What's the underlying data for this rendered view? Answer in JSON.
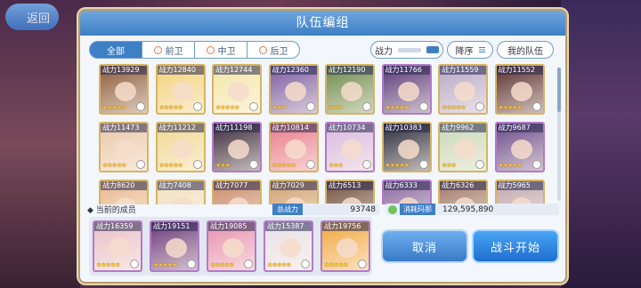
{
  "back_label": "返回",
  "panel_title": "队伍编组",
  "filter_tabs": [
    {
      "label": "全部",
      "active": true
    },
    {
      "label": "前卫",
      "active": false
    },
    {
      "label": "中卫",
      "active": false
    },
    {
      "label": "后卫",
      "active": false
    }
  ],
  "sort_field_label": "战力",
  "sort_order_label": "降序",
  "my_team_label": "我的队伍",
  "power_prefix": "战力",
  "roster": [
    {
      "power": "13929",
      "stars": 5,
      "frame": "gold",
      "color": "#8a5a3a"
    },
    {
      "power": "12840",
      "stars": 5,
      "frame": "gold",
      "color": "#f2d27a"
    },
    {
      "power": "12744",
      "stars": 5,
      "frame": "gold",
      "color": "#f5e6a8"
    },
    {
      "power": "12360",
      "stars": 3,
      "frame": "gold",
      "color": "#7a5aa0"
    },
    {
      "power": "12190",
      "stars": 3,
      "frame": "gold",
      "color": "#6a8a4a"
    },
    {
      "power": "11766",
      "stars": 5,
      "frame": "purple",
      "color": "#5a3a7a"
    },
    {
      "power": "11559",
      "stars": 5,
      "frame": "gold",
      "color": "#b6a8c8"
    },
    {
      "power": "11552",
      "stars": 5,
      "frame": "gold",
      "color": "#5a3030"
    },
    {
      "power": "11473",
      "stars": 5,
      "frame": "gold",
      "color": "#e9c8a8"
    },
    {
      "power": "11212",
      "stars": 5,
      "frame": "gold",
      "color": "#f0d890"
    },
    {
      "power": "11198",
      "stars": 3,
      "frame": "purple",
      "color": "#3a2a3a"
    },
    {
      "power": "10814",
      "stars": 5,
      "frame": "gold",
      "color": "#e87a8a"
    },
    {
      "power": "10734",
      "stars": 3,
      "frame": "purple",
      "color": "#d8b8e0"
    },
    {
      "power": "10383",
      "stars": 5,
      "frame": "gold",
      "color": "#2a2a3a"
    },
    {
      "power": "9962",
      "stars": 3,
      "frame": "gold",
      "color": "#c8d8b8"
    },
    {
      "power": "9687",
      "stars": 5,
      "frame": "purple",
      "color": "#6a4a8a"
    },
    {
      "power": "8620",
      "stars": 5,
      "frame": "gold",
      "color": "#e8b890"
    },
    {
      "power": "7408",
      "stars": 3,
      "frame": "gold",
      "color": "#f0e0c0"
    },
    {
      "power": "7077",
      "stars": 3,
      "frame": "gold",
      "color": "#c88a6a"
    },
    {
      "power": "7029",
      "stars": 3,
      "frame": "gold",
      "color": "#d0a070"
    },
    {
      "power": "6513",
      "stars": 3,
      "frame": "gold",
      "color": "#705040"
    },
    {
      "power": "6333",
      "stars": 3,
      "frame": "purple",
      "color": "#8a6aa0"
    },
    {
      "power": "6326",
      "stars": 3,
      "frame": "gold",
      "color": "#a07a6a"
    },
    {
      "power": "5965",
      "stars": 3,
      "frame": "gold",
      "color": "#c0a8b0"
    }
  ],
  "current_members_label": "当前的成员",
  "total_power_label": "总战力",
  "total_power_value": "93748",
  "mana_cost_label": "消耗玛那",
  "mana_value": "129,595,890",
  "party": [
    {
      "power": "16359",
      "stars": 5,
      "frame": "purple",
      "color": "#e8c0c8"
    },
    {
      "power": "19151",
      "stars": 5,
      "frame": "purple",
      "color": "#6a3a7a"
    },
    {
      "power": "19085",
      "stars": 5,
      "frame": "purple",
      "color": "#e890b0"
    },
    {
      "power": "15387",
      "stars": 5,
      "frame": "purple",
      "color": "#e8e0e8"
    },
    {
      "power": "19756",
      "stars": 5,
      "frame": "purple",
      "color": "#f0a840"
    }
  ],
  "cancel_label": "取消",
  "start_label": "战斗开始"
}
